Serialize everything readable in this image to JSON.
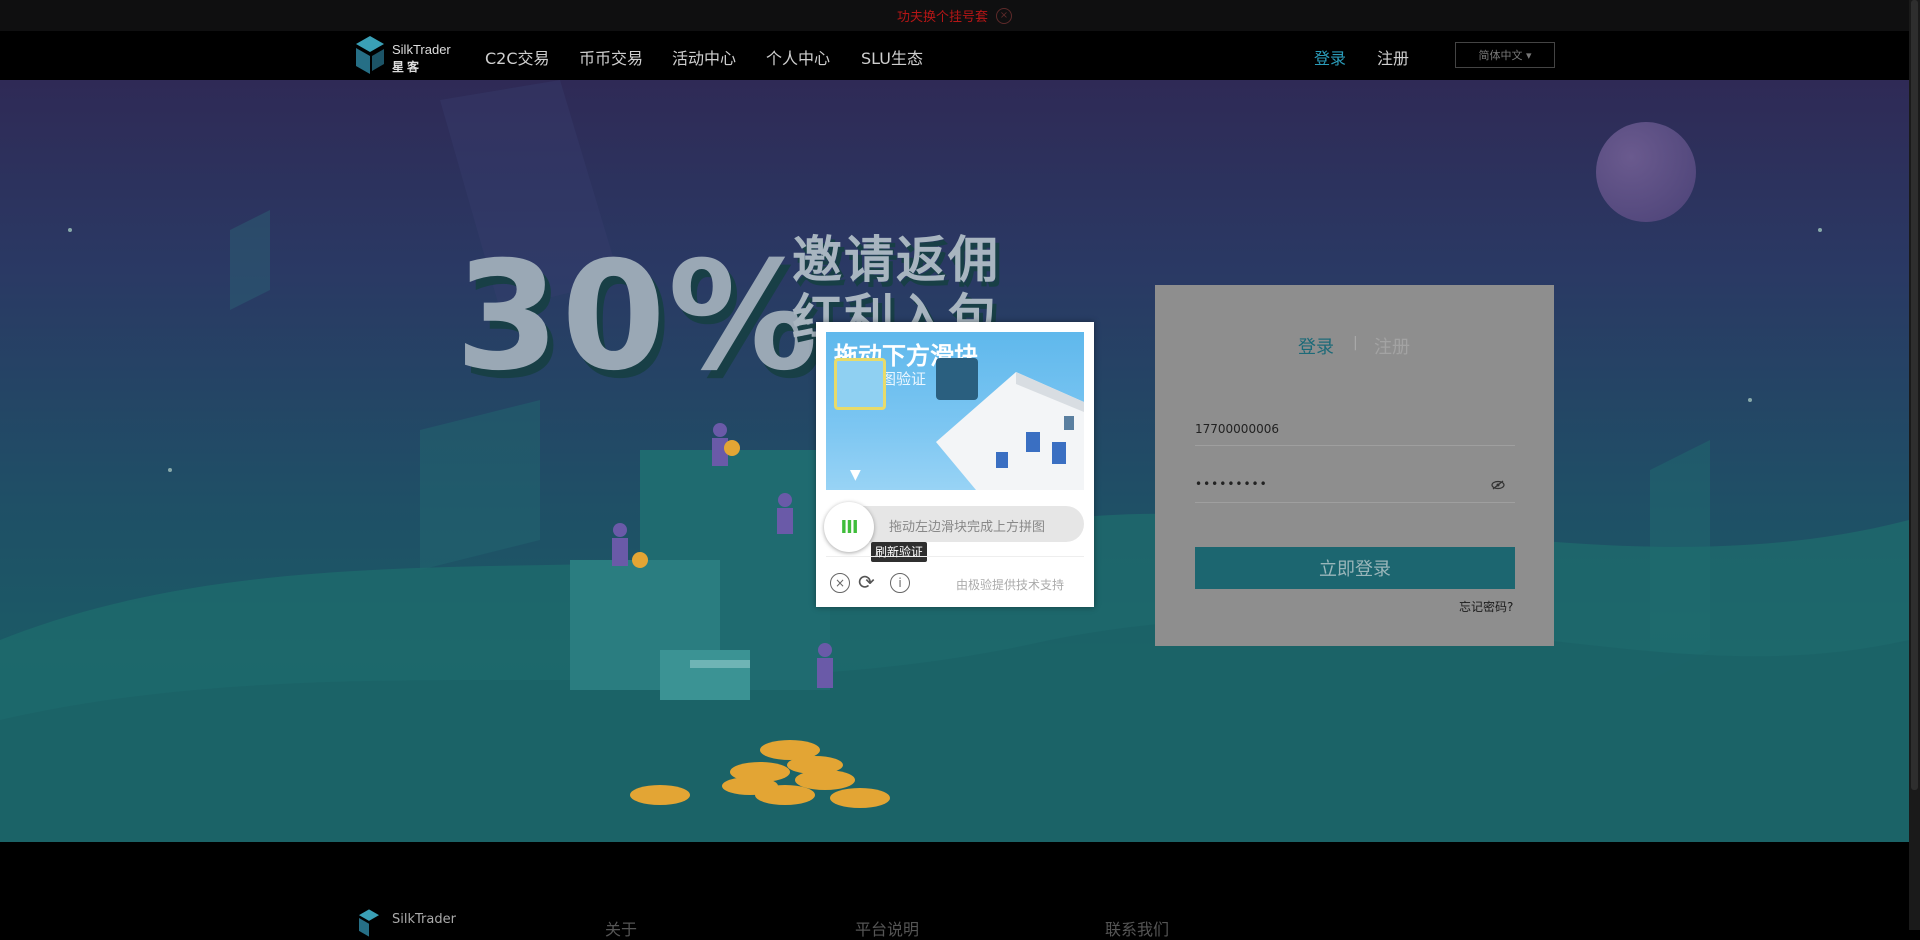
{
  "notice": {
    "text": "功夫换个挂号套"
  },
  "nav": {
    "brand_en": "SilkTrader",
    "brand_cn": "星客",
    "items": [
      "C2C交易",
      "币币交易",
      "活动中心",
      "个人中心",
      "SLU生态"
    ],
    "login": "登录",
    "register": "注册",
    "language": "简体中文 ▾"
  },
  "promo": {
    "percent": "30%",
    "line1": "邀请返佣",
    "line2": "红利入包"
  },
  "login_card": {
    "tab_login": "登录",
    "tab_separator": "|",
    "tab_register": "注册",
    "phone_value": "17700000006",
    "password_value": "•••••••••",
    "submit": "立即登录",
    "forgot": "忘记密码?"
  },
  "captcha": {
    "title": "拖动下方滑块",
    "subtitle": "拼图验证",
    "slider_hint": "拖动左边滑块完成上方拼图",
    "tooltip": "刷新验证",
    "powered_by": "由极验提供技术支持"
  },
  "footer": {
    "brand_en": "SilkTrader",
    "col_about": "关于",
    "col_platform": "平台说明",
    "col_contact": "联系我们"
  }
}
